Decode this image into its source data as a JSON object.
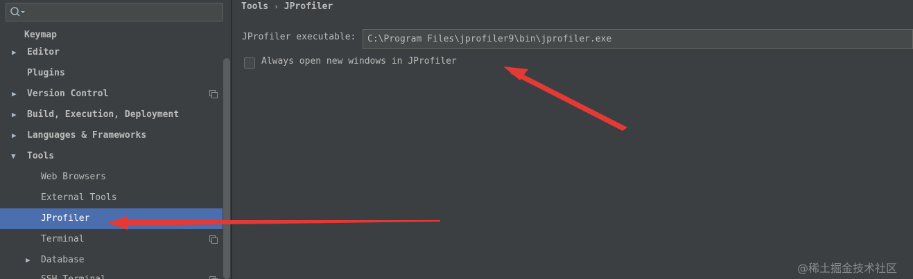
{
  "search": {
    "value": "",
    "placeholder": ""
  },
  "sidebar": {
    "items": [
      {
        "label": "Keymap"
      },
      {
        "label": "Editor"
      },
      {
        "label": "Plugins"
      },
      {
        "label": "Version Control"
      },
      {
        "label": "Build, Execution, Deployment"
      },
      {
        "label": "Languages & Frameworks"
      },
      {
        "label": "Tools"
      },
      {
        "label": "Web Browsers"
      },
      {
        "label": "External Tools"
      },
      {
        "label": "JProfiler"
      },
      {
        "label": "Terminal"
      },
      {
        "label": "Database"
      },
      {
        "label": "SSH Terminal"
      }
    ]
  },
  "breadcrumb": {
    "parent": "Tools",
    "separator": "›",
    "current": "JProfiler"
  },
  "settings": {
    "executable_label": "JProfiler executable:",
    "executable_value": "C:\\Program Files\\jprofiler9\\bin\\jprofiler.exe",
    "checkbox_label": "Always open new windows in JProfiler",
    "checkbox_checked": false
  },
  "watermark": "@稀土掘金技术社区",
  "colors": {
    "background": "#3c3f41",
    "selection": "#4b6eaf",
    "annotation_arrow": "#e53935"
  }
}
